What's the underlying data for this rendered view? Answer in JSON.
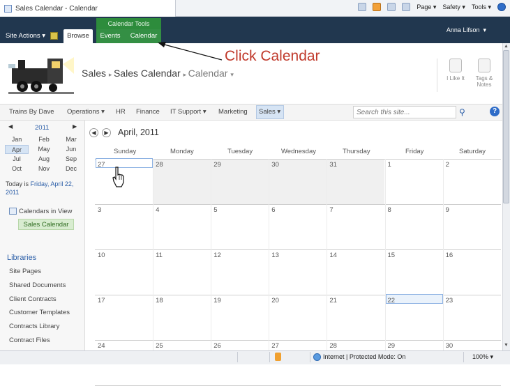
{
  "browser": {
    "tab_title": "Sales Calendar - Calendar",
    "commands": {
      "page": "Page",
      "safety": "Safety",
      "tools": "Tools"
    }
  },
  "ribbon": {
    "site_actions": "Site Actions",
    "tab_browse": "Browse",
    "context_group": "Calendar Tools",
    "tab_events": "Events",
    "tab_calendar": "Calendar",
    "user": "Anna Lifson"
  },
  "annotation": "Click Calendar",
  "breadcrumb": {
    "site": "Sales",
    "list": "Sales Calendar",
    "view": "Calendar"
  },
  "header_actions": {
    "like": "I Like It",
    "tags": "Tags & Notes"
  },
  "topnav": {
    "items": [
      "Trains By Dave",
      "Operations",
      "HR",
      "Finance",
      "IT Support",
      "Marketing",
      "Sales"
    ],
    "search_placeholder": "Search this site...",
    "help": "?"
  },
  "date_picker": {
    "year": "2011",
    "months": [
      "Jan",
      "Feb",
      "Mar",
      "Apr",
      "May",
      "Jun",
      "Jul",
      "Aug",
      "Sep",
      "Oct",
      "Nov",
      "Dec"
    ],
    "selected_month": "Apr",
    "today_prefix": "Today is",
    "today_value": "Friday, April 22, 2011"
  },
  "calendars_in_view": {
    "heading": "Calendars in View",
    "item": "Sales Calendar"
  },
  "libraries": {
    "heading": "Libraries",
    "items": [
      "Site Pages",
      "Shared Documents",
      "Client Contracts",
      "Customer Templates",
      "Contracts Library",
      "Contract Files"
    ]
  },
  "calendar": {
    "title": "April, 2011",
    "days": [
      "Sunday",
      "Monday",
      "Tuesday",
      "Wednesday",
      "Thursday",
      "Friday",
      "Saturday"
    ],
    "weeks": [
      [
        "27",
        "28",
        "29",
        "30",
        "31",
        "1",
        "2"
      ],
      [
        "3",
        "4",
        "5",
        "6",
        "7",
        "8",
        "9"
      ],
      [
        "10",
        "11",
        "12",
        "13",
        "14",
        "15",
        "16"
      ],
      [
        "17",
        "18",
        "19",
        "20",
        "21",
        "22",
        "23"
      ],
      [
        "24",
        "25",
        "26",
        "27",
        "28",
        "29",
        "30"
      ]
    ]
  },
  "status_bar": {
    "zone": "Internet | Protected Mode: On",
    "zoom": "100%"
  }
}
